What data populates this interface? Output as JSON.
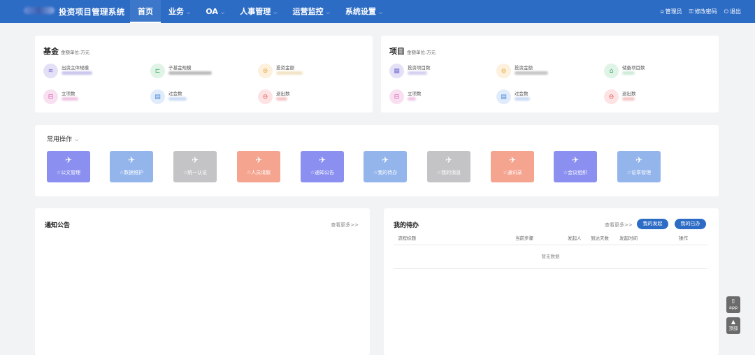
{
  "header": {
    "app_title": "投资项目管理系统",
    "nav": [
      {
        "label": "首页",
        "active": true,
        "has_menu": false
      },
      {
        "label": "业务",
        "active": false,
        "has_menu": true
      },
      {
        "label": "OA",
        "active": false,
        "has_menu": true
      },
      {
        "label": "人事管理",
        "active": false,
        "has_menu": true
      },
      {
        "label": "运营监控",
        "active": false,
        "has_menu": true
      },
      {
        "label": "系统设置",
        "active": false,
        "has_menu": true
      }
    ],
    "user_label": "管理员",
    "change_password_label": "修改密码",
    "logout_label": "退出",
    "colors": {
      "bar": "#2d6cc5"
    }
  },
  "fund": {
    "title": "基金",
    "unit": "金额单位:万元",
    "stats": [
      {
        "label": "出资主体规模",
        "icon": "layers-icon"
      },
      {
        "label": "子基金规模",
        "icon": "structure-icon"
      },
      {
        "label": "投资金额",
        "icon": "coins-icon"
      },
      {
        "label": "立项数",
        "icon": "inbox-icon"
      },
      {
        "label": "过会数",
        "icon": "document-icon"
      },
      {
        "label": "退出数",
        "icon": "exit-icon"
      }
    ]
  },
  "project": {
    "title": "项目",
    "unit": "金额单位:万元",
    "stats": [
      {
        "label": "投资项目数",
        "icon": "calendar-icon"
      },
      {
        "label": "投资金额",
        "icon": "coins-icon"
      },
      {
        "label": "储备项目数",
        "icon": "warehouse-icon"
      },
      {
        "label": "立项数",
        "icon": "inbox-icon"
      },
      {
        "label": "过会数",
        "icon": "document-icon"
      },
      {
        "label": "退出数",
        "icon": "exit-icon"
      }
    ]
  },
  "quick_ops": {
    "title": "常用操作",
    "tiles": [
      {
        "label": "☆公文管理",
        "color": "#8a8ff0"
      },
      {
        "label": "☆数据维护",
        "color": "#93b5ec"
      },
      {
        "label": "☆统一认证",
        "color": "#c4c4c6"
      },
      {
        "label": "☆人员请假",
        "color": "#f5a490"
      },
      {
        "label": "☆通知公告",
        "color": "#8a8ff0"
      },
      {
        "label": "☆我的待办",
        "color": "#93b5ec"
      },
      {
        "label": "☆我的消息",
        "color": "#c4c4c6"
      },
      {
        "label": "☆通讯录",
        "color": "#f5a490"
      },
      {
        "label": "☆会议组织",
        "color": "#8a8ff0"
      },
      {
        "label": "☆证章管理",
        "color": "#93b5ec"
      }
    ]
  },
  "notice": {
    "title": "通知公告",
    "more": "查看更多>>"
  },
  "todo": {
    "title": "我的待办",
    "more": "查看更多>>",
    "btn_initiated": "我的发起",
    "btn_done": "我的已办",
    "columns": [
      "流程标题",
      "当前步骤",
      "发起人",
      "到达天数",
      "发起时间",
      "操作"
    ],
    "empty_text": "暂无数据"
  },
  "float": {
    "app_label": "app",
    "top_label": "顶部"
  }
}
